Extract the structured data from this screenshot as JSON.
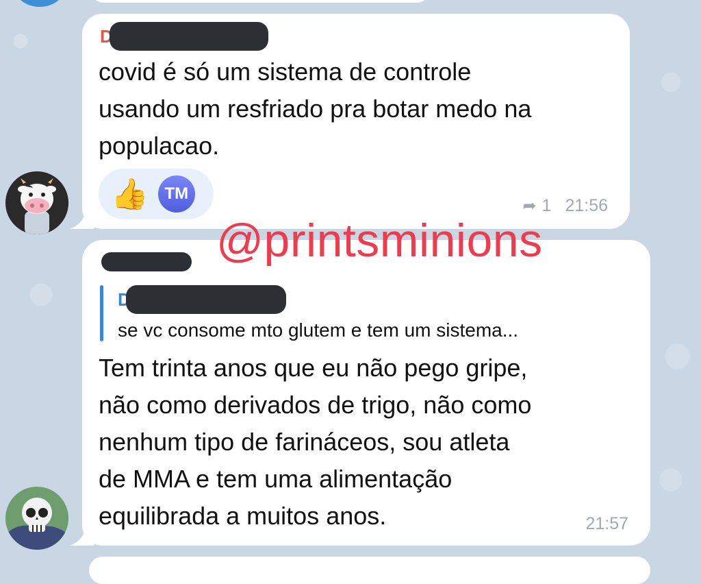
{
  "watermark": "@printsminions",
  "messages": [
    {
      "sender_fragment": "D",
      "text": "covid é só um sistema de controle\nusando um resfriado pra botar medo na\npopulacao.",
      "reactions": {
        "emoji": "👍",
        "user_initials": "TM"
      },
      "reply_icon": "reply-arrow-icon",
      "reply_count": "1",
      "time": "21:56",
      "avatar": "cow-emoji-avatar"
    },
    {
      "quote_fragment": "D",
      "quote_text": "se vc consome mto glutem e tem um sistema...",
      "text": "Tem trinta anos que eu não pego gripe,\nnão como derivados de trigo, não como\nnenhum tipo de farináceos, sou atleta\nde MMA e tem uma alimentação\nequilibrada a muitos anos.",
      "time": "21:57",
      "avatar": "skull-emoji-avatar"
    }
  ],
  "colors": {
    "background": "#c9d6e3",
    "bubble": "#ffffff",
    "watermark": "#ee3b4d",
    "accent": "#3a86d6",
    "meta": "#a2a8b0",
    "sender_name": "#e05745"
  }
}
